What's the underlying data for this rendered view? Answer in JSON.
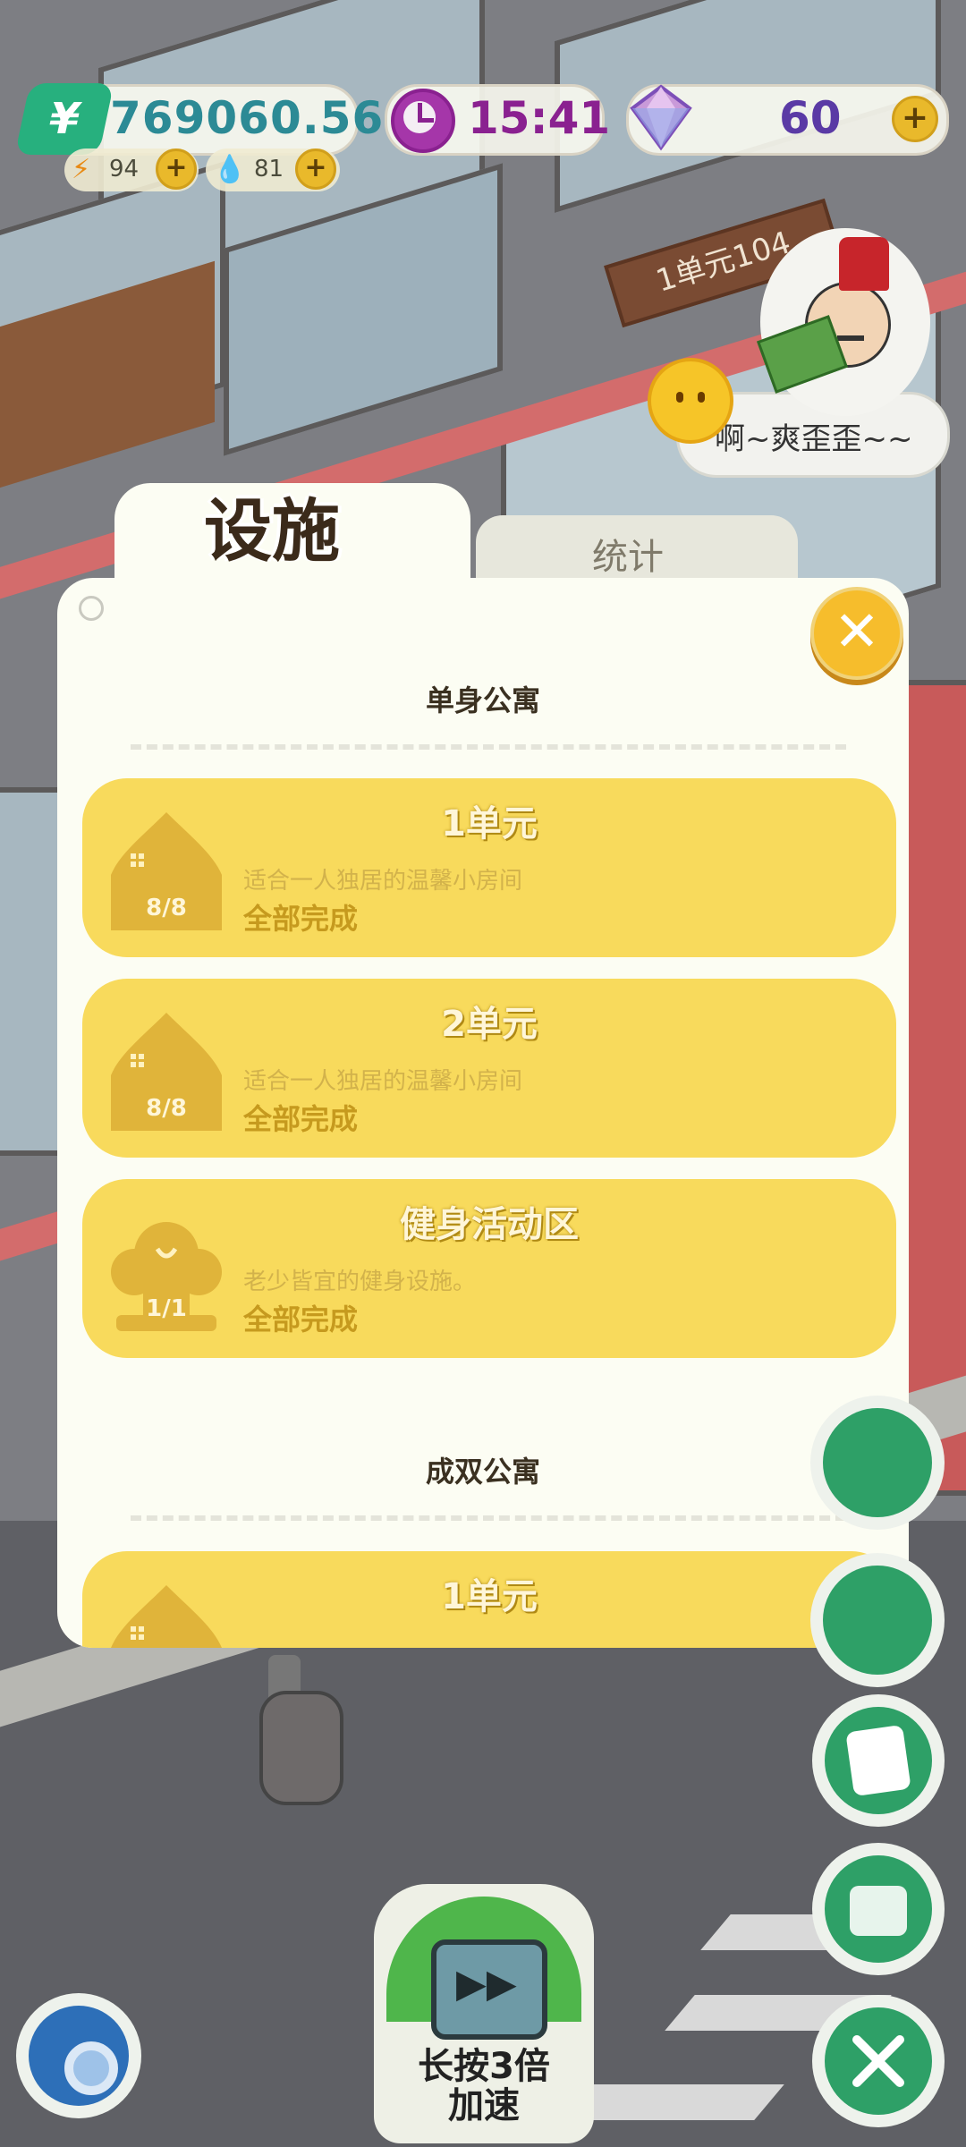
{
  "hud": {
    "money": "769060.56",
    "money_symbol": "¥",
    "energy": "94",
    "water": "81",
    "time": "15:41",
    "gems": "60"
  },
  "scene": {
    "unit_sign": "1单元104",
    "npc_speech": "啊~爽歪歪~~"
  },
  "dialog": {
    "tabs": [
      {
        "label": "设施",
        "active": true
      },
      {
        "label": "统计",
        "active": false
      }
    ],
    "sections": [
      {
        "title": "单身公寓",
        "items": [
          {
            "title": "1单元",
            "desc": "适合一人独居的温馨小房间",
            "status": "全部完成",
            "count": "8/8",
            "icon": "house-icon"
          },
          {
            "title": "2单元",
            "desc": "适合一人独居的温馨小房间",
            "status": "全部完成",
            "count": "8/8",
            "icon": "house-icon"
          },
          {
            "title": "健身活动区",
            "desc": "老少皆宜的健身设施。",
            "status": "全部完成",
            "count": "1/1",
            "icon": "fitness-icon"
          }
        ]
      },
      {
        "title": "成双公寓",
        "items": [
          {
            "title": "1单元",
            "icon": "house-icon"
          }
        ]
      }
    ]
  },
  "controls": {
    "speed_label_line1": "长按3倍",
    "speed_label_line2": "加速"
  },
  "colors": {
    "card": "#f8da5c",
    "panel": "#fcfdf3",
    "accent_green": "#2ea067",
    "close": "#f6bd2c"
  }
}
